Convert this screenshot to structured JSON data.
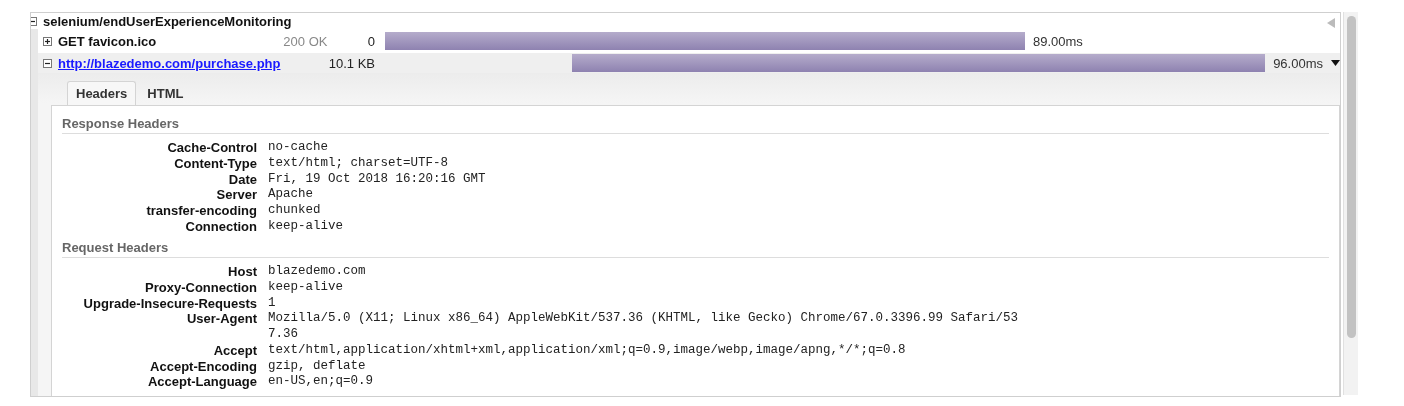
{
  "group": {
    "title": "selenium/endUserExperienceMonitoring",
    "expanded": true
  },
  "requests": [
    {
      "name": "GET favicon.ico",
      "link": false,
      "status": "200 OK",
      "size": "0",
      "time": "89.00ms",
      "expanded": false
    },
    {
      "name": "http://blazedemo.com/purchase.php",
      "link": true,
      "size": "10.1 KB",
      "time": "96.00ms",
      "expanded": true
    }
  ],
  "tabs": [
    {
      "label": "Headers",
      "selected": true
    },
    {
      "label": "HTML",
      "selected": false
    }
  ],
  "sections": [
    {
      "title": "Response Headers",
      "headers": [
        {
          "key": "Cache-Control",
          "value": "no-cache"
        },
        {
          "key": "Content-Type",
          "value": "text/html; charset=UTF-8"
        },
        {
          "key": "Date",
          "value": "Fri, 19 Oct 2018 16:20:16 GMT"
        },
        {
          "key": "Server",
          "value": "Apache"
        },
        {
          "key": "transfer-encoding",
          "value": "chunked"
        },
        {
          "key": "Connection",
          "value": "keep-alive"
        }
      ]
    },
    {
      "title": "Request Headers",
      "headers": [
        {
          "key": "Host",
          "value": "blazedemo.com"
        },
        {
          "key": "Proxy-Connection",
          "value": "keep-alive"
        },
        {
          "key": "Upgrade-Insecure-Requests",
          "value": "1"
        },
        {
          "key": "User-Agent",
          "value": "Mozilla/5.0 (X11; Linux x86_64) AppleWebKit/537.36 (KHTML, like Gecko) Chrome/67.0.3396.99 Safari/537.36"
        },
        {
          "key": "Accept",
          "value": "text/html,application/xhtml+xml,application/xml;q=0.9,image/webp,image/apng,*/*;q=0.8"
        },
        {
          "key": "Accept-Encoding",
          "value": "gzip, deflate"
        },
        {
          "key": "Accept-Language",
          "value": "en-US,en;q=0.9"
        }
      ]
    }
  ]
}
